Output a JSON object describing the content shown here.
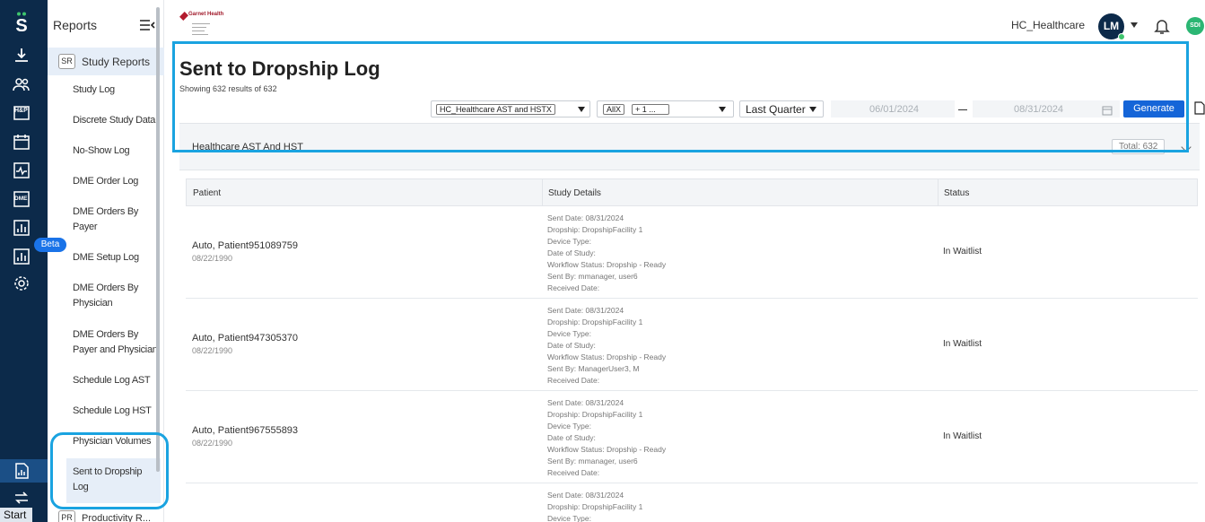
{
  "rail": {
    "icons": [
      "brand-s-icon",
      "download-icon",
      "users-icon",
      "hp-icon",
      "calendar-icon",
      "activity-icon",
      "dme-icon",
      "bar-chart-icon",
      "bar-chart-beta-icon",
      "settings-icon"
    ],
    "beta_label": "Beta",
    "bottom_icons": [
      "reports-icon",
      "sync-icon"
    ],
    "start_label": "Start",
    "hp_text": "H&P",
    "dme_text": "DME"
  },
  "sidebar": {
    "title": "Reports",
    "group_badge": "SR",
    "group_label": "Study Reports",
    "items": [
      "Study Log",
      "Discrete Study Data",
      "No-Show Log",
      "DME Order Log",
      "DME Orders By Payer",
      "DME Setup Log",
      "DME Orders By Physician",
      "DME Orders By Payer and Physician",
      "Schedule Log AST",
      "Schedule Log HST",
      "Physician Volumes",
      "Sent to Dropship Log"
    ],
    "next_group_badge": "PR",
    "next_group_label": "Productivity R..."
  },
  "topbar": {
    "logo_text": "Garnet Health",
    "account_name": "HC_Healthcare",
    "avatar_initials": "LM",
    "org_badge": "SDI"
  },
  "header": {
    "title": "Sent to Dropship Log",
    "results": "Showing 632 results of 632",
    "filter_site_chip": "HC_Healthcare AST and HST",
    "filter_site_chip_x": "X",
    "filter_type_chip": "All",
    "filter_type_chip_x": "X",
    "filter_type_more": "+ 1 ...",
    "period": "Last Quarter",
    "date_from": "06/01/2024",
    "date_to": "08/31/2024",
    "generate_label": "Generate"
  },
  "section": {
    "title": "Healthcare AST And HST",
    "total": "Total: 632"
  },
  "table": {
    "columns": [
      "Patient",
      "Study Details",
      "Status"
    ],
    "rows": [
      {
        "name": "Auto, Patient951089759",
        "dob": "08/22/1990",
        "details": [
          "Sent Date: 08/31/2024",
          "Dropship: DropshipFacility 1",
          "Device Type:",
          "Date of Study:",
          "Workflow Status: Dropship - Ready",
          "Sent By: mmanager, user6",
          "Received Date:"
        ],
        "status": "In Waitlist"
      },
      {
        "name": "Auto, Patient947305370",
        "dob": "08/22/1990",
        "details": [
          "Sent Date: 08/31/2024",
          "Dropship: DropshipFacility 1",
          "Device Type:",
          "Date of Study:",
          "Workflow Status: Dropship - Ready",
          "Sent By: ManagerUser3, M",
          "Received Date:"
        ],
        "status": "In Waitlist"
      },
      {
        "name": "Auto, Patient967555893",
        "dob": "08/22/1990",
        "details": [
          "Sent Date: 08/31/2024",
          "Dropship: DropshipFacility 1",
          "Device Type:",
          "Date of Study:",
          "Workflow Status: Dropship - Ready",
          "Sent By: mmanager, user6",
          "Received Date:"
        ],
        "status": "In Waitlist"
      },
      {
        "name": "",
        "dob": "",
        "details": [
          "Sent Date: 08/31/2024",
          "Dropship: DropshipFacility 1",
          "Device Type:"
        ],
        "status": ""
      }
    ]
  },
  "colors": {
    "rail_bg": "#0c2a4a",
    "accent_blue": "#1565d8",
    "highlight_outline": "#1aa3e0",
    "active_item_bg": "#e6eef8",
    "avatar_bg": "#0c2a4a",
    "org_badge_bg": "#2bb673"
  }
}
